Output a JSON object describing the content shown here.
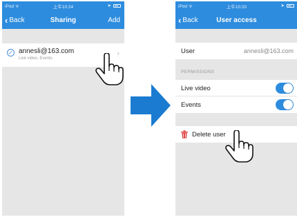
{
  "left_screen": {
    "status": {
      "device": "iPod ᯤ",
      "time": "上午10:24"
    },
    "nav": {
      "back_label": "Back",
      "title": "Sharing",
      "action_label": "Add"
    },
    "share_item": {
      "email": "annesli@163.com",
      "permissions": "Live video, Events"
    }
  },
  "right_screen": {
    "status": {
      "device": "iPod ᯤ",
      "time": "上午10:20"
    },
    "nav": {
      "back_label": "Back",
      "title": "User access"
    },
    "user": {
      "label": "User",
      "value": "annesli@163.com"
    },
    "permissions_header": "PERMISSIONS",
    "permissions": [
      {
        "label": "Live video",
        "enabled": true
      },
      {
        "label": "Events",
        "enabled": true
      }
    ],
    "delete_label": "Delete user"
  },
  "colors": {
    "nav_blue": "#2d8cde",
    "arrow_blue": "#1b7bd0",
    "toggle_on": "#2d8cde",
    "trash_red": "#e04848"
  }
}
